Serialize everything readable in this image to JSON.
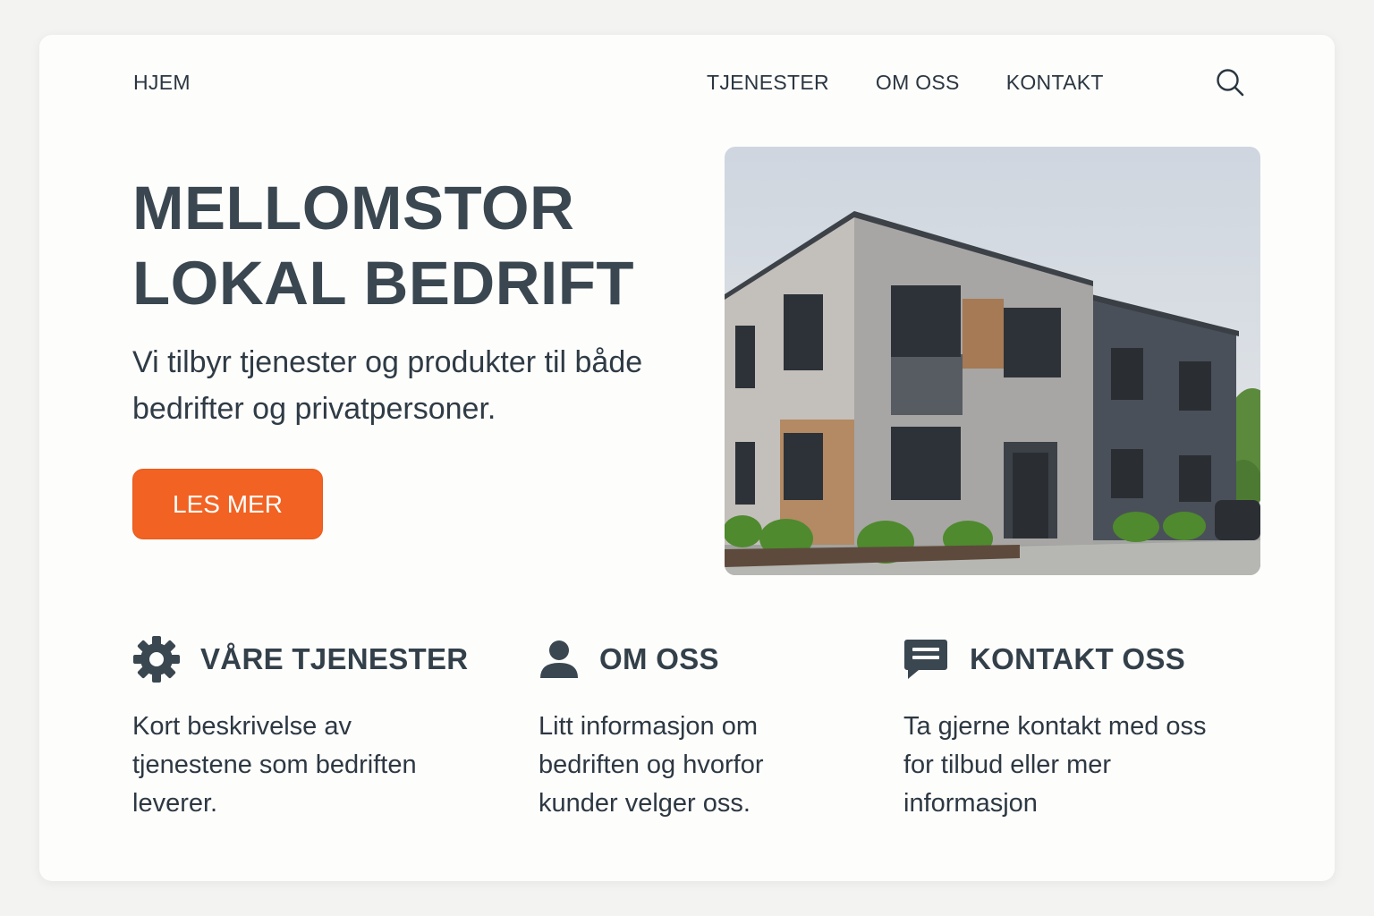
{
  "nav": {
    "home": "HJEM",
    "links": [
      "TJENESTER",
      "OM OSS",
      "KONTAKT"
    ],
    "search_icon": "search-icon"
  },
  "hero": {
    "title_line1": "MELLOMSTOR",
    "title_line2": "LOKAL BEDRIFT",
    "text": "Vi tilbyr tjenester og produkter til både bedrifter og privatpersoner.",
    "button": "LES MER",
    "image": "building-photo"
  },
  "features": [
    {
      "icon": "gear-icon",
      "title": "VÅRE TJENESTER",
      "text": "Kort beskrivelse av tjenestene som bedriften leverer."
    },
    {
      "icon": "user-icon",
      "title": "OM OSS",
      "text": "Litt informasjon om bedriften og hvorfor kunder velger oss."
    },
    {
      "icon": "chat-icon",
      "title": "KONTAKT OSS",
      "text": "Ta gjerne kontakt med oss for tilbud eller mer informasjon"
    }
  ],
  "colors": {
    "accent": "#f26222",
    "text": "#2f3a44",
    "background": "#fdfdfc"
  }
}
